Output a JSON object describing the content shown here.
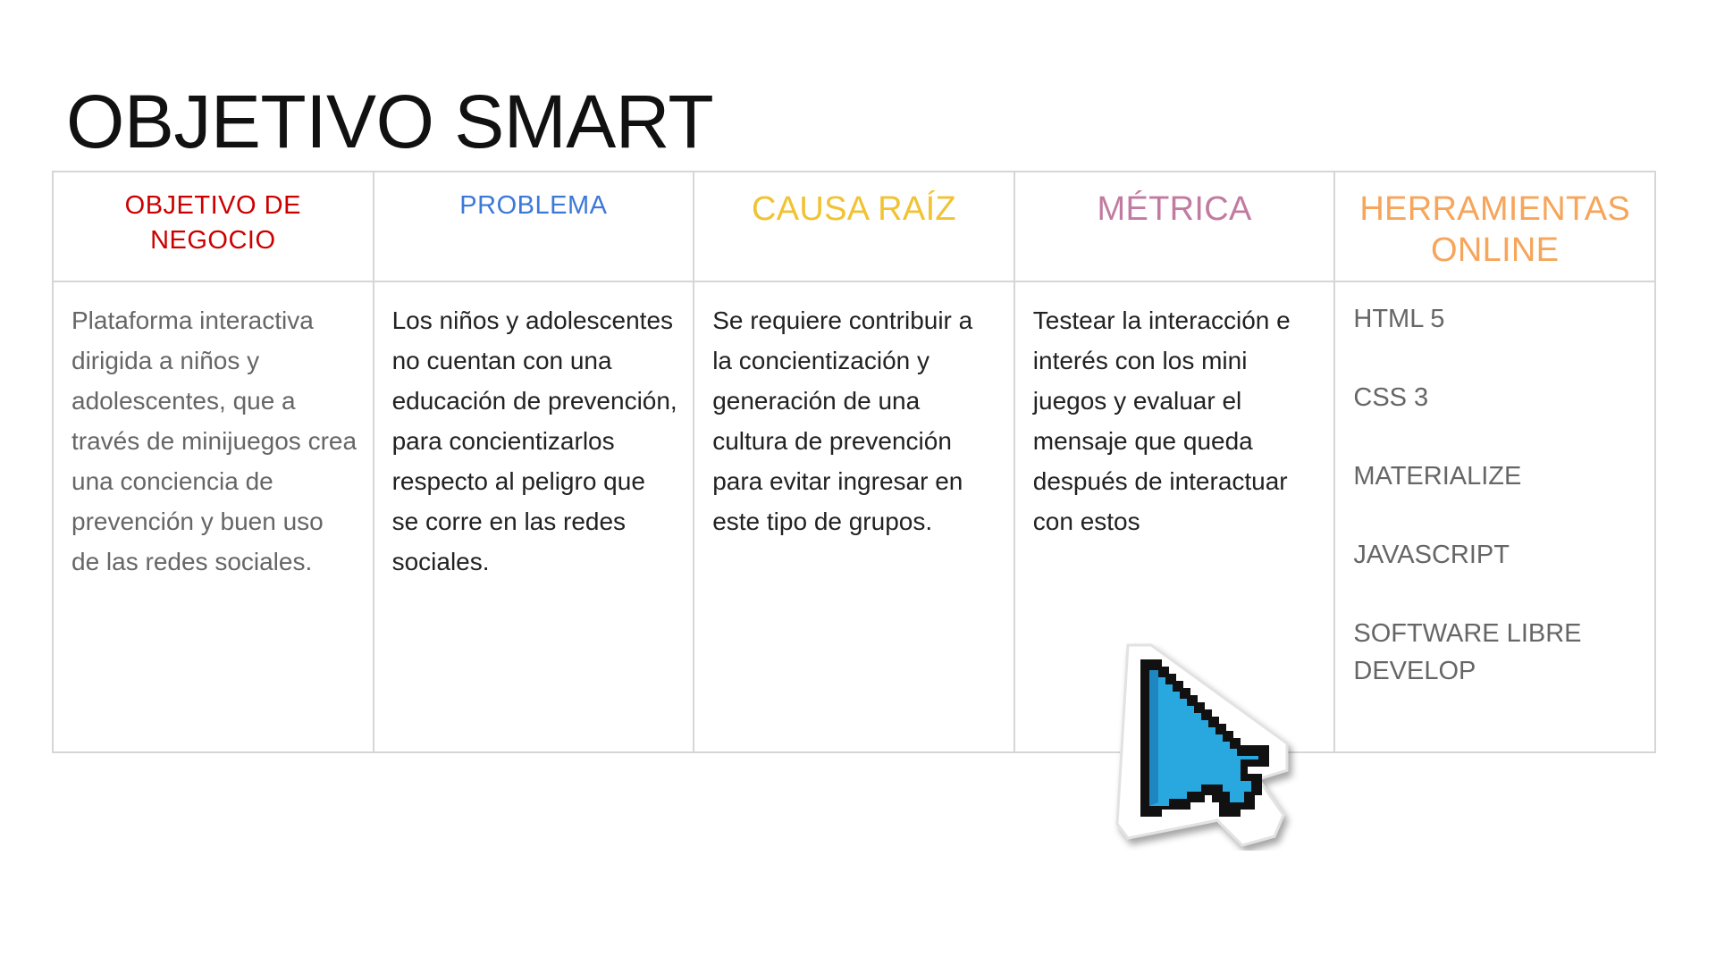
{
  "slide": {
    "title": "OBJETIVO SMART"
  },
  "table": {
    "headers": [
      {
        "label": "OBJETIVO DE NEGOCIO",
        "color": "#cc0000"
      },
      {
        "label": "PROBLEMA",
        "color": "#3c78d8"
      },
      {
        "label": "CAUSA RAÍZ",
        "color": "#f1c232"
      },
      {
        "label": "MÉTRICA",
        "color": "#c27ba0"
      },
      {
        "label": "HERRAMIENTAS ONLINE",
        "color": "#f6a55a"
      }
    ],
    "cells": {
      "objetivo": "Plataforma interactiva dirigida a niños y adolescentes, que a través de minijuegos crea una conciencia de prevención y buen uso de las redes sociales.",
      "problema": "Los niños y adolescentes no cuentan con una educación de prevención, para concientizarlos respecto al peligro que se corre en las redes sociales.",
      "causa": "Se requiere contribuir a la concientización y generación de una cultura de prevención para evitar ingresar en este tipo de grupos.",
      "metrica": "Testear la interacción e interés con los mini juegos y evaluar el mensaje que queda después de interactuar con estos",
      "herramientas": [
        "HTML 5",
        "CSS 3",
        "MATERIALIZE",
        "JAVASCRIPT",
        "SOFTWARE LIBRE DEVELOP"
      ]
    }
  },
  "cursor": {
    "icon": "pointer-cursor-icon",
    "fill_color": "#29a8e0"
  }
}
